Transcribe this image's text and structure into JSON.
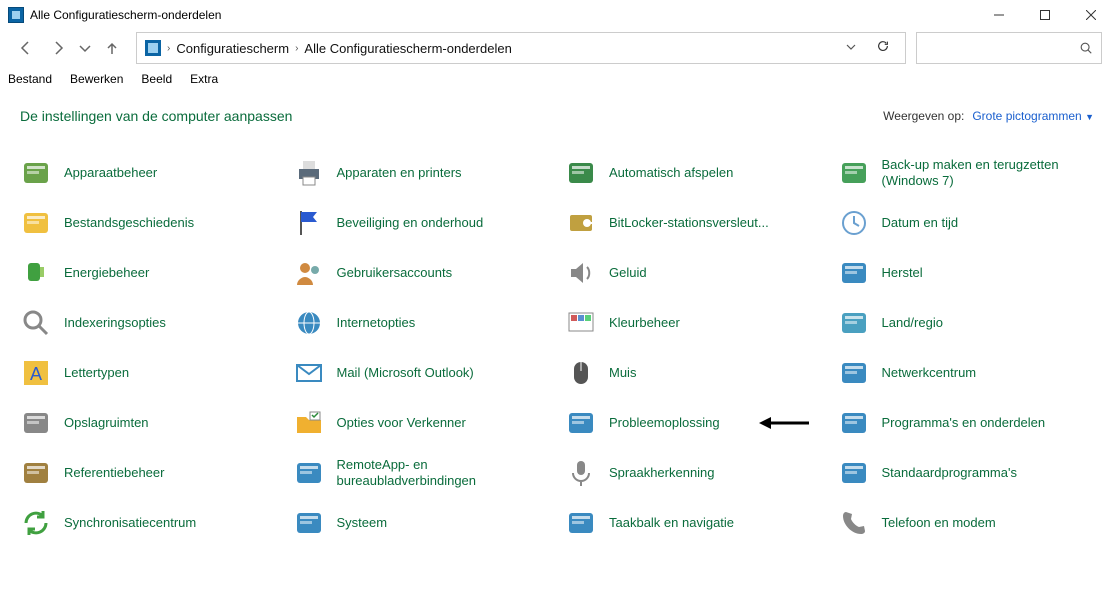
{
  "window": {
    "title": "Alle Configuratiescherm-onderdelen"
  },
  "breadcrumb": {
    "root": "Configuratiescherm",
    "current": "Alle Configuratiescherm-onderdelen"
  },
  "menu": {
    "file": "Bestand",
    "edit": "Bewerken",
    "view": "Beeld",
    "extra": "Extra"
  },
  "header": {
    "title": "De instellingen van de computer aanpassen",
    "view_label": "Weergeven op:",
    "view_value": "Grote pictogrammen"
  },
  "items": [
    {
      "id": "device-manager",
      "label": "Apparaatbeheer",
      "icon": "device-manager-icon"
    },
    {
      "id": "devices-printers",
      "label": "Apparaten en printers",
      "icon": "printer-icon"
    },
    {
      "id": "autoplay",
      "label": "Automatisch afspelen",
      "icon": "autoplay-icon"
    },
    {
      "id": "backup",
      "label": "Back-up maken en terugzetten (Windows 7)",
      "icon": "backup-icon"
    },
    {
      "id": "file-history",
      "label": "Bestandsgeschiedenis",
      "icon": "file-history-icon"
    },
    {
      "id": "security",
      "label": "Beveiliging en onderhoud",
      "icon": "flag-icon"
    },
    {
      "id": "bitlocker",
      "label": "BitLocker-stationsversleut...",
      "icon": "bitlocker-icon"
    },
    {
      "id": "date-time",
      "label": "Datum en tijd",
      "icon": "clock-icon"
    },
    {
      "id": "power",
      "label": "Energiebeheer",
      "icon": "power-icon"
    },
    {
      "id": "user-accounts",
      "label": "Gebruikersaccounts",
      "icon": "users-icon"
    },
    {
      "id": "sound",
      "label": "Geluid",
      "icon": "speaker-icon"
    },
    {
      "id": "recovery",
      "label": "Herstel",
      "icon": "recovery-icon"
    },
    {
      "id": "indexing",
      "label": "Indexeringsopties",
      "icon": "search-icon"
    },
    {
      "id": "internet-options",
      "label": "Internetopties",
      "icon": "globe-icon"
    },
    {
      "id": "color",
      "label": "Kleurbeheer",
      "icon": "color-icon"
    },
    {
      "id": "region",
      "label": "Land/regio",
      "icon": "region-icon"
    },
    {
      "id": "fonts",
      "label": "Lettertypen",
      "icon": "fonts-icon"
    },
    {
      "id": "mail",
      "label": "Mail (Microsoft Outlook)",
      "icon": "mail-icon"
    },
    {
      "id": "mouse",
      "label": "Muis",
      "icon": "mouse-icon"
    },
    {
      "id": "network",
      "label": "Netwerkcentrum",
      "icon": "network-icon"
    },
    {
      "id": "storage-spaces",
      "label": "Opslagruimten",
      "icon": "storage-icon"
    },
    {
      "id": "explorer-options",
      "label": "Opties voor Verkenner",
      "icon": "folder-options-icon",
      "arrow": true
    },
    {
      "id": "troubleshoot",
      "label": "Probleemoplossing",
      "icon": "troubleshoot-icon"
    },
    {
      "id": "programs",
      "label": "Programma's en onderdelen",
      "icon": "programs-icon"
    },
    {
      "id": "credentials",
      "label": "Referentiebeheer",
      "icon": "safe-icon"
    },
    {
      "id": "remoteapp",
      "label": "RemoteApp- en bureaubladverbindingen",
      "icon": "remote-icon"
    },
    {
      "id": "speech",
      "label": "Spraakherkenning",
      "icon": "mic-icon"
    },
    {
      "id": "default-programs",
      "label": "Standaardprogramma's",
      "icon": "default-programs-icon"
    },
    {
      "id": "sync",
      "label": "Synchronisatiecentrum",
      "icon": "sync-icon"
    },
    {
      "id": "system",
      "label": "Systeem",
      "icon": "system-icon"
    },
    {
      "id": "taskbar",
      "label": "Taakbalk en navigatie",
      "icon": "taskbar-icon"
    },
    {
      "id": "phone-modem",
      "label": "Telefoon en modem",
      "icon": "phone-icon"
    }
  ],
  "iconColors": {
    "device-manager-icon": "#6aa24a",
    "printer-icon": "#5a6a7a",
    "autoplay-icon": "#3a8a4a",
    "backup-icon": "#46a05a",
    "file-history-icon": "#f0c040",
    "flag-icon": "#2a5ad0",
    "bitlocker-icon": "#c0a040",
    "clock-icon": "#6aa0d0",
    "power-icon": "#40a040",
    "users-icon": "#d08a40",
    "speaker-icon": "#888",
    "recovery-icon": "#3a8ac0",
    "search-icon": "#888",
    "globe-icon": "#3a8ac0",
    "color-icon": "#d05a5a",
    "region-icon": "#4aa0c0",
    "fonts-icon": "#f0c040",
    "mail-icon": "#3a8ac0",
    "mouse-icon": "#555",
    "network-icon": "#3a8ac0",
    "storage-icon": "#888",
    "folder-options-icon": "#f0b030",
    "troubleshoot-icon": "#3a8ac0",
    "programs-icon": "#3a8ac0",
    "safe-icon": "#a08040",
    "remote-icon": "#3a8ac0",
    "mic-icon": "#888",
    "default-programs-icon": "#3a8ac0",
    "sync-icon": "#40a040",
    "system-icon": "#3a8ac0",
    "taskbar-icon": "#3a8ac0",
    "phone-icon": "#888"
  }
}
